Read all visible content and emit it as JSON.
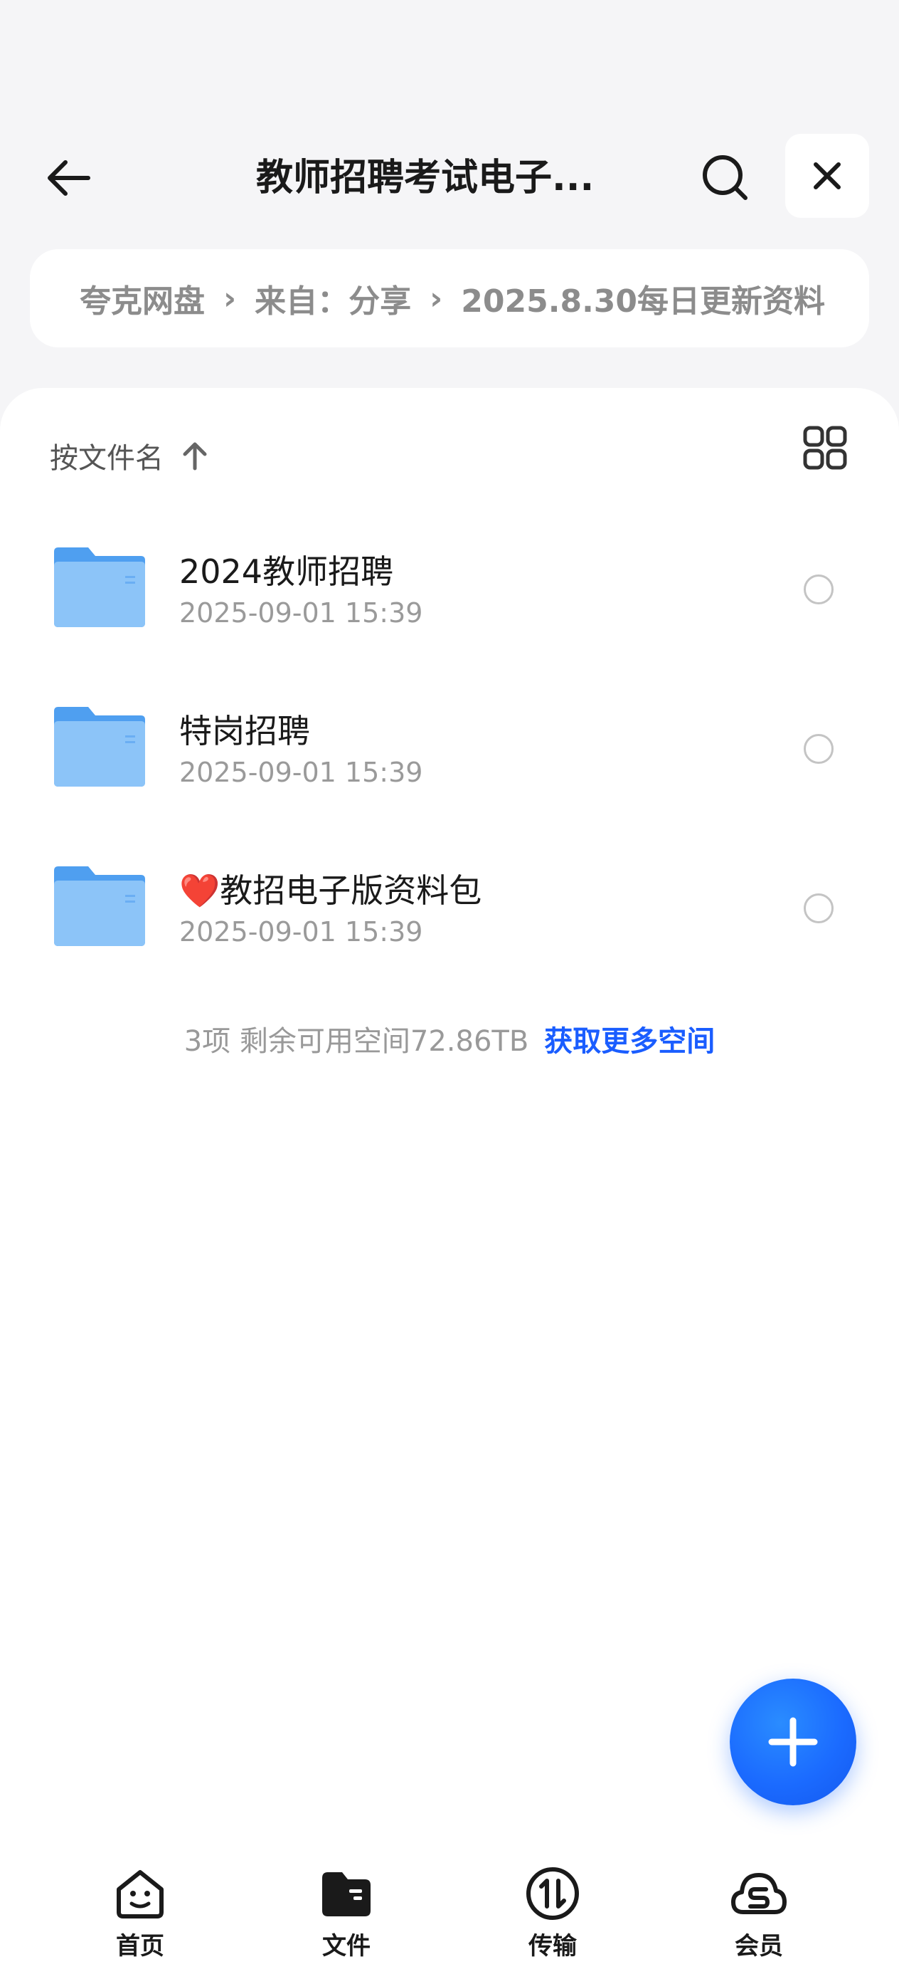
{
  "header": {
    "title": "教师招聘考试电子...",
    "back_icon": "arrow-left-icon",
    "search_icon": "search-icon",
    "close_icon": "close-icon"
  },
  "breadcrumb": {
    "items": [
      "夸克网盘",
      "来自：分享",
      "2025.8.30每日更新资料"
    ],
    "separator": "›"
  },
  "sort": {
    "label": "按文件名",
    "direction_icon": "arrow-up-icon",
    "view_toggle_icon": "grid-view-icon"
  },
  "files": [
    {
      "name": "2024教师招聘",
      "date": "2025-09-01 15:39",
      "icon": "folder-icon"
    },
    {
      "name": "特岗招聘",
      "date": "2025-09-01 15:39",
      "icon": "folder-icon"
    },
    {
      "name": "❤️教招电子版资料包",
      "date": "2025-09-01 15:39",
      "icon": "folder-icon"
    }
  ],
  "summary": {
    "text": "3项 剩余可用空间72.86TB",
    "link": "获取更多空间"
  },
  "fab": {
    "icon": "plus-icon"
  },
  "bottom_nav": [
    {
      "label": "首页",
      "icon": "home-smile-icon"
    },
    {
      "label": "文件",
      "icon": "folder-file-icon"
    },
    {
      "label": "传输",
      "icon": "transfer-icon"
    },
    {
      "label": "会员",
      "icon": "cloud-member-icon"
    }
  ],
  "colors": {
    "accent": "#1a5dff",
    "background": "#f5f5f7",
    "folder": "#5aa8f5"
  }
}
